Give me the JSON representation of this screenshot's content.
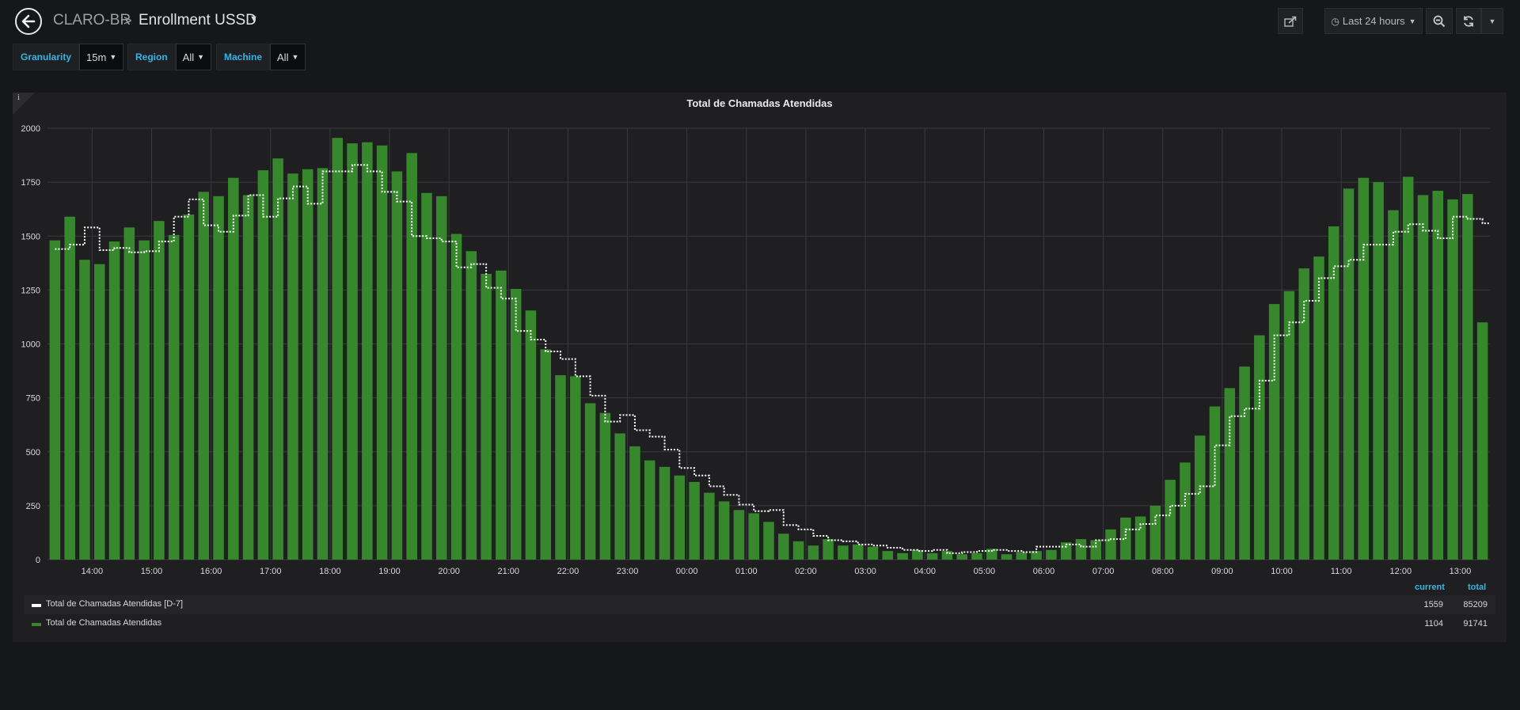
{
  "navbar": {
    "folder": "CLARO-BR",
    "separator": ">",
    "title": "Enrollment USSD",
    "time_range": "Last 24 hours"
  },
  "variables": [
    {
      "label": "Granularity",
      "value": "15m"
    },
    {
      "label": "Region",
      "value": "All"
    },
    {
      "label": "Machine",
      "value": "All"
    }
  ],
  "panel": {
    "info": "i",
    "title": "Total de Chamadas Atendidas"
  },
  "legend": {
    "headers": {
      "current": "current",
      "total": "total"
    },
    "rows": [
      {
        "name": "Total de Chamadas Atendidas [D-7]",
        "current": "1559",
        "total": "85209",
        "color": "#ffffff"
      },
      {
        "name": "Total de Chamadas Atendidas",
        "current": "1104",
        "total": "91741",
        "color": "#37872d"
      }
    ]
  },
  "colors": {
    "bar": "#37872d",
    "line": "#ffffff",
    "background": "#161719",
    "panel": "#1f1f22",
    "accent": "#33b5e5"
  },
  "chart_data": {
    "type": "bar",
    "title": "Total de Chamadas Atendidas",
    "ylim": [
      0,
      2000
    ],
    "y_ticks": [
      "0",
      "250",
      "500",
      "750",
      "1000",
      "1250",
      "1500",
      "1750",
      "2000"
    ],
    "x_ticks": [
      "14:00",
      "15:00",
      "16:00",
      "17:00",
      "18:00",
      "19:00",
      "20:00",
      "21:00",
      "22:00",
      "23:00",
      "00:00",
      "01:00",
      "02:00",
      "03:00",
      "04:00",
      "05:00",
      "06:00",
      "07:00",
      "08:00",
      "09:00",
      "10:00",
      "11:00",
      "12:00",
      "13:00"
    ],
    "x_start": "13:15",
    "interval": "15m",
    "grid": true,
    "series": [
      {
        "name": "Total de Chamadas Atendidas",
        "type": "bar",
        "values": [
          1480,
          1590,
          1390,
          1370,
          1475,
          1540,
          1480,
          1570,
          1505,
          1600,
          1705,
          1685,
          1770,
          1690,
          1805,
          1860,
          1790,
          1810,
          1815,
          1955,
          1930,
          1935,
          1920,
          1800,
          1885,
          1700,
          1685,
          1510,
          1430,
          1325,
          1340,
          1255,
          1155,
          975,
          855,
          850,
          725,
          680,
          585,
          525,
          460,
          430,
          390,
          360,
          310,
          270,
          230,
          215,
          175,
          120,
          85,
          65,
          95,
          65,
          70,
          60,
          40,
          30,
          45,
          30,
          40,
          25,
          30,
          50,
          25,
          35,
          40,
          45,
          80,
          95,
          90,
          140,
          195,
          200,
          250,
          370,
          450,
          575,
          710,
          795,
          895,
          1040,
          1185,
          1245,
          1350,
          1405,
          1545,
          1720,
          1770,
          1750,
          1620,
          1775,
          1690,
          1710,
          1670,
          1695,
          1100
        ],
        "color": "#37872d"
      },
      {
        "name": "Total de Chamadas Atendidas [D-7]",
        "type": "step-line",
        "values": [
          1440,
          1460,
          1540,
          1435,
          1445,
          1425,
          1430,
          1475,
          1590,
          1670,
          1550,
          1520,
          1595,
          1690,
          1590,
          1675,
          1730,
          1650,
          1800,
          1800,
          1830,
          1800,
          1705,
          1660,
          1500,
          1490,
          1475,
          1355,
          1370,
          1260,
          1210,
          1060,
          1020,
          965,
          930,
          850,
          760,
          640,
          670,
          600,
          570,
          510,
          425,
          390,
          340,
          300,
          255,
          225,
          230,
          160,
          140,
          110,
          90,
          85,
          70,
          65,
          55,
          45,
          40,
          45,
          30,
          35,
          40,
          45,
          40,
          35,
          60,
          60,
          70,
          60,
          90,
          95,
          140,
          165,
          205,
          250,
          305,
          340,
          530,
          665,
          700,
          830,
          1040,
          1100,
          1200,
          1305,
          1360,
          1390,
          1460,
          1460,
          1520,
          1555,
          1525,
          1490,
          1590,
          1580,
          1559
        ]
      }
    ]
  }
}
